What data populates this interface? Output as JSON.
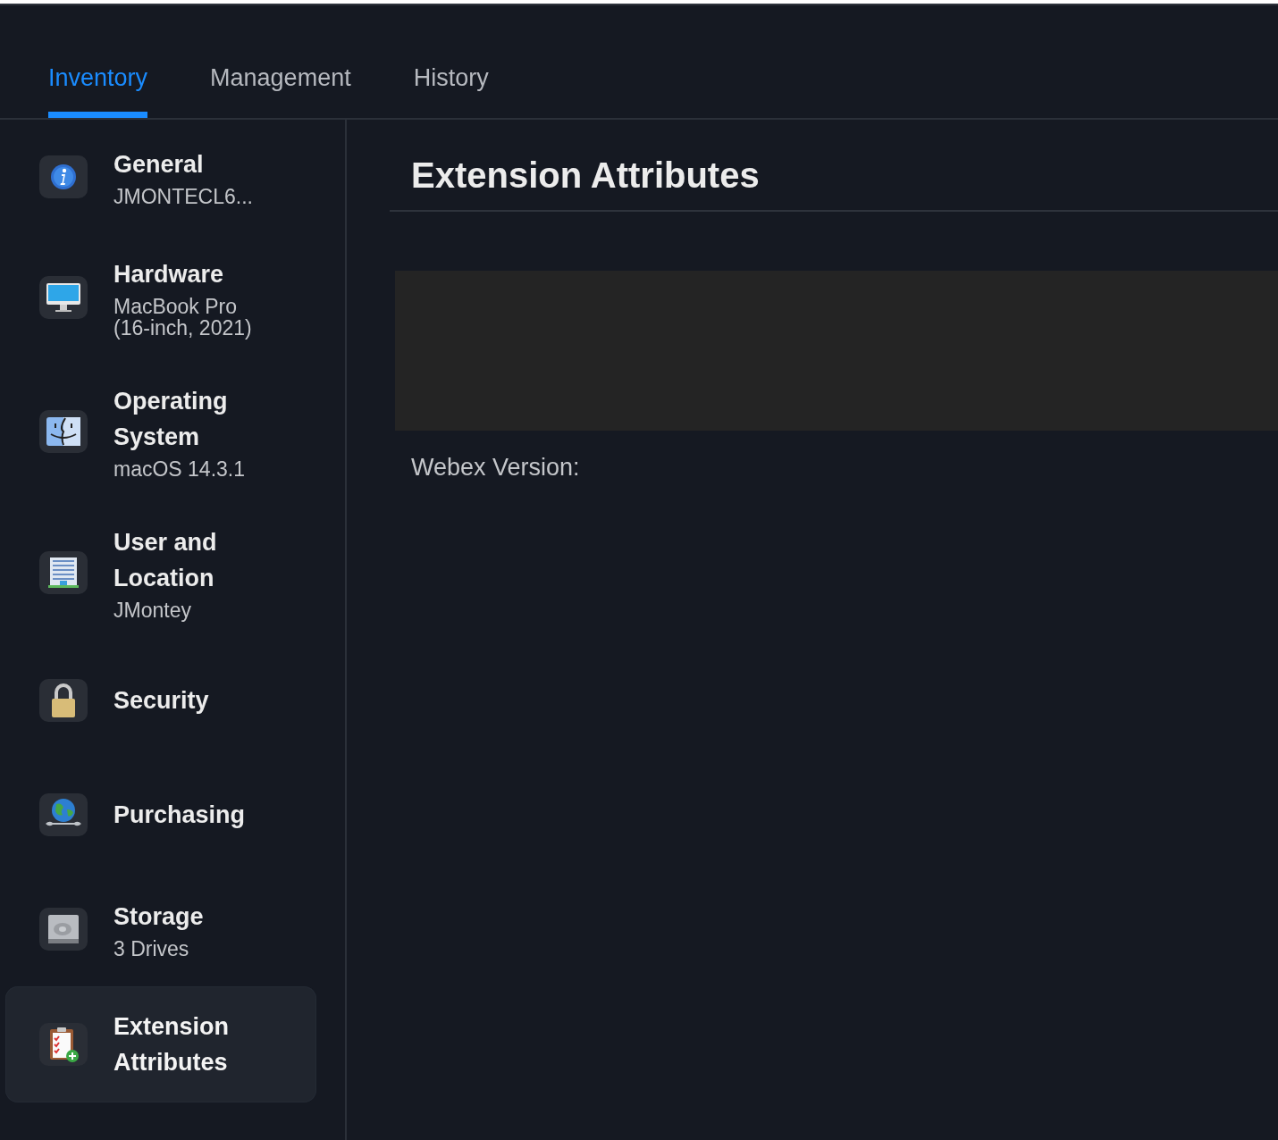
{
  "tabs": [
    {
      "label": "Inventory",
      "selected": true
    },
    {
      "label": "Management",
      "selected": false
    },
    {
      "label": "History",
      "selected": false
    }
  ],
  "sidebar": {
    "items": [
      {
        "title": "General",
        "subtitle": "JMONTECL6...",
        "selected": false
      },
      {
        "title": "Hardware",
        "subtitle": "MacBook Pro (16-inch, 2021)",
        "selected": false
      },
      {
        "title": "Operating System",
        "subtitle": "macOS 14.3.1",
        "selected": false
      },
      {
        "title": "User and Location",
        "subtitle": "JMontey",
        "selected": false
      },
      {
        "title": "Security",
        "selected": false
      },
      {
        "title": "Purchasing",
        "selected": false
      },
      {
        "title": "Storage",
        "subtitle": "3 Drives",
        "selected": false
      },
      {
        "title": "Extension Attributes",
        "selected": true
      }
    ]
  },
  "content": {
    "title": "Extension Attributes",
    "fields": [
      {
        "label": "Webex Version:"
      }
    ]
  }
}
